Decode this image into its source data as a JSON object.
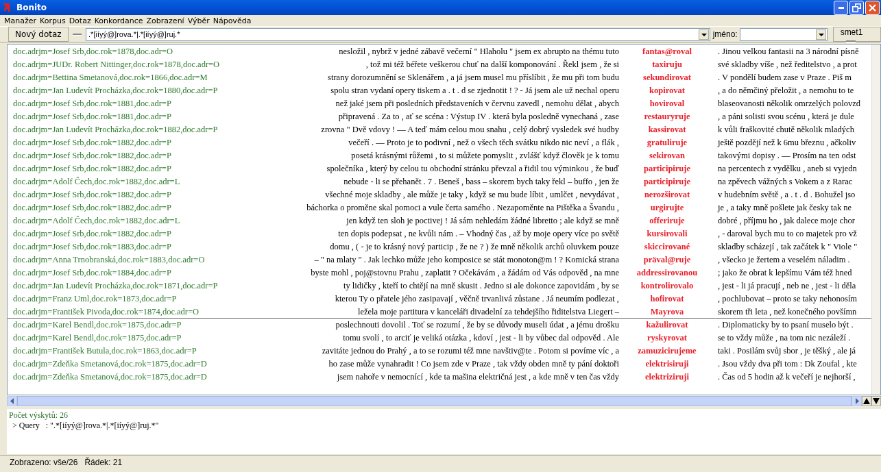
{
  "window": {
    "title": "Bonito"
  },
  "menu": [
    "Manažer",
    "Korpus",
    "Dotaz",
    "Konkordance",
    "Zobrazení",
    "Výběr",
    "Nápověda"
  ],
  "toolbar": {
    "new_query": "Nový dotaz",
    "query": ".*[iíyý@]rova.*|.*[iíyý@]ruj.*",
    "name_label": "jméno:",
    "corpus": "smet1"
  },
  "rows": [
    {
      "ref": "doc.adrjm=Josef Srb,doc.rok=1878,doc.adr=O",
      "left": "nesložil , nybrž v jedné zábavě večerní \" Hlaholu \" jsem ex abrupto na thému tuto",
      "keyword": "fantas@roval",
      "right": ". Jinou velkou fantasii na 3 národní písně",
      "current": false
    },
    {
      "ref": "doc.adrjm=JUDr. Robert Nittinger,doc.rok=1878,doc.adr=O",
      "left": ", tož mi též béřete veškerou chuť na další komponování . Řekl jsem , že si",
      "keyword": "taxiruju",
      "right": "své skladby víše , než ředitelstvo , a prot",
      "current": false
    },
    {
      "ref": "doc.adrjm=Bettina Smetanová,doc.rok=1866,doc.adr=M",
      "left": "strany dorozumnění se Sklenářem , a já jsem musel mu příslíbit , že mu při tom budu",
      "keyword": "sekundirovat",
      "right": ". V pondělí budem zase v Praze . Piš m",
      "current": false
    },
    {
      "ref": "doc.adrjm=Jan Ludevít Procházka,doc.rok=1880,doc.adr=P",
      "left": "spolu stran vydaní opery tiskem a . t . d se zjednotit ! ? - Já jsem ale už nechal operu",
      "keyword": "kopirovat",
      "right": ", a do němčiný přeložit , a nemohu to te",
      "current": false
    },
    {
      "ref": "doc.adrjm=Josef Srb,doc.rok=1881,doc.adr=P",
      "left": "než jaké jsem při posledních představeních v červnu zavedl , nemohu dělat , abych",
      "keyword": "hoviroval",
      "right": "blaseovanosti několik omrzelých polovzd",
      "current": false
    },
    {
      "ref": "doc.adrjm=Josef Srb,doc.rok=1881,doc.adr=P",
      "left": "připravená . Za to , ať se scéna : Výstup IV . která byla posledně vynechaná , zase",
      "keyword": "restauryruje",
      "right": ", a páni solisti svou scénu , která je dule",
      "current": false
    },
    {
      "ref": "doc.adrjm=Jan Ludevít Procházka,doc.rok=1882,doc.adr=P",
      "left": "zrovna \" Dvě vdovy ! — A teď mám celou mou snahu , celý dobrý vysledek své hudby",
      "keyword": "kassirovat",
      "right": "k vůli fraškovité chutě několik mladých",
      "current": false
    },
    {
      "ref": "doc.adrjm=Josef Srb,doc.rok=1882,doc.adr=P",
      "left": "večeří . — Proto je to podivní , než o všech těch svátku nikdo nic neví , a flák ,",
      "keyword": "gratuliruje",
      "right": "ještě pozdějí než k 6mu březnu , ačkoliv",
      "current": false
    },
    {
      "ref": "doc.adrjm=Josef Srb,doc.rok=1882,doc.adr=P",
      "left": "posetá krásnými růžemi , to si můžete pomyslit , zvlášť když člověk je k tomu",
      "keyword": "sekirovan",
      "right": "takovými dopisy . — Prosím na ten odst",
      "current": false
    },
    {
      "ref": "doc.adrjm=Josef Srb,doc.rok=1882,doc.adr=P",
      "left": "společníka , který by celou tu obchodní stránku převzal a řidil tou výminkou , že buď",
      "keyword": "participiruje",
      "right": "na percentech z vydělku , aneb si vyjedn",
      "current": false
    },
    {
      "ref": "doc.adrjm=Adolf Čech,doc.rok=1882,doc.adr=L",
      "left": "nebude - li se přehanět . 7 . Beneš , bass – skorem bych taky řekl – buffo , jen že",
      "keyword": "participiruje",
      "right": "na zpěvech vážných s Vokem a z Rarac",
      "current": false
    },
    {
      "ref": "doc.adrjm=Josef Srb,doc.rok=1882,doc.adr=P",
      "left": "všechné moje skladby , ale může je taky , když se mu bude líbit , umlčet , nevydávat ,",
      "keyword": "nerozširovat",
      "right": "v hudebním světě , a . t . d . Bohužel jso",
      "current": false
    },
    {
      "ref": "doc.adrjm=Josef Srb,doc.rok=1882,doc.adr=P",
      "left": "báchorka o proměne skal pomoci a vule čerta samého . Nezapoměnte na Pištěka a Švandu ,",
      "keyword": "urgirujte",
      "right": "je , a taky mně pošlete jak česky tak ne",
      "current": false
    },
    {
      "ref": "doc.adrjm=Adolf Čech,doc.rok=1882,doc.adr=L",
      "left": "jen když ten sloh je poctivej ! Já sám nehledám žádné libretto ; ale když se mně",
      "keyword": "offeriruje",
      "right": "dobré , příjmu ho , jak dalece moje chor",
      "current": false
    },
    {
      "ref": "doc.adrjm=Josef Srb,doc.rok=1882,doc.adr=P",
      "left": "ten dopis podepsat , ne kvůli nám . – Vhodný čas , až by moje opery více po světě",
      "keyword": "kursirovali",
      "right": ", - daroval bych mu to co majetek pro vž",
      "current": false
    },
    {
      "ref": "doc.adrjm=Josef Srb,doc.rok=1883,doc.adr=P",
      "left": "domu , ( - je to krásný nový particip , že ne ? ) že mně několik archů oluvkem pouze",
      "keyword": "skiccirované",
      "right": "skladby scházejí , tak začátek k \" Viole \"",
      "current": false
    },
    {
      "ref": "doc.adrjm=Anna Trnobranská,doc.rok=1883,doc.adr=O",
      "left": "– \" na mlaty \" . Jak lechko může jeho komposice se stát monoton@m ! ? Komická strana",
      "keyword": "präval@ruje",
      "right": ", všecko je žertem a veselém náladim .",
      "current": false
    },
    {
      "ref": "doc.adrjm=Josef Srb,doc.rok=1884,doc.adr=P",
      "left": "byste mohl , poj@stovnu Prahu , zaplatit ? Očekávám , a žádám od Vás odpověd , na mne",
      "keyword": "addressirovanou",
      "right": "; jako že obrat k lepšímu Vám též hned",
      "current": false
    },
    {
      "ref": "doc.adrjm=Jan Ludevít Procházka,doc.rok=1871,doc.adr=P",
      "left": "ty lidičky , kteří to chtějí na mně skusit . Jedno si ale dokonce zapovidám , by se",
      "keyword": "kontrolirovalo",
      "right": ", jest - li já pracují , neb ne , jest - li děla",
      "current": false
    },
    {
      "ref": "doc.adrjm=Franz Uml,doc.rok=1873,doc.adr=P",
      "left": "kterou Ty o přatele jého zasipavají , věčně trvanlivá zůstane . Já neumím podlezat ,",
      "keyword": "hofirovat",
      "right": ", pochlubovat – proto se taky nehonosím",
      "current": false
    },
    {
      "ref": "doc.adrjm=František Pivoda,doc.rok=1874,doc.adr=O",
      "left": "ležela moje partitura v kanceláři divadelní za tehdejšího řiditelstva Liegert –",
      "keyword": "Mayrova",
      "right": "skorem tři leta , než konečného povšímn",
      "current": true
    },
    {
      "ref": "doc.adrjm=Karel Bendl,doc.rok=1875,doc.adr=P",
      "left": "poslechnouti dovolil . Toť se rozumí , že by se důvody museli údat , a jému drošku",
      "keyword": "kažulirovat",
      "right": ". Diplomaticky by to psaní muselo být .",
      "current": false
    },
    {
      "ref": "doc.adrjm=Karel Bendl,doc.rok=1875,doc.adr=P",
      "left": "tomu svolí , to arciť je veliká otázka , kdoví , jest - li by vůbec dal odpověd . Ale",
      "keyword": "ryskyrovat",
      "right": "se to vždy může , na tom nic nezáleží .",
      "current": false
    },
    {
      "ref": "doc.adrjm=František Butula,doc.rok=1863,doc.adr=P",
      "left": "zavitáte jednou do Prahý , a to se rozumi též mne navštiv@te . Potom si povíme víc , a",
      "keyword": "zamuzicirujeme",
      "right": "taki . Posilám svůj sbor , je těšký , ale já",
      "current": false
    },
    {
      "ref": "doc.adrjm=Zdeňka Smetanová,doc.rok=1875,doc.adr=D",
      "left": "ho zase může vynahradit ! Co jsem zde v Praze , tak vždy obden mně ty pání doktoři",
      "keyword": "elektrisiruji",
      "right": ". Jsou vždy dva při tom : Dk Zoufal , kte",
      "current": false
    },
    {
      "ref": "doc.adrjm=Zdeňka Smetanová,doc.rok=1875,doc.adr=D",
      "left": "jsem nahoře v nemocnící , kde ta mašina električná jest , a kde mně v ten čas vždy",
      "keyword": "elektriziruji",
      "right": ". Čas od 5 hodin až k večeří je nejhorší ,",
      "current": false
    }
  ],
  "info": {
    "count": "Počet výskytů: 26",
    "query_line": "> Query   : \".*[iíyý@]rova.*|.*[iíyý@]ruj.*\""
  },
  "status_bar": {
    "displayed": "Zobrazeno: vše/26",
    "row": "Řádek: 21"
  }
}
